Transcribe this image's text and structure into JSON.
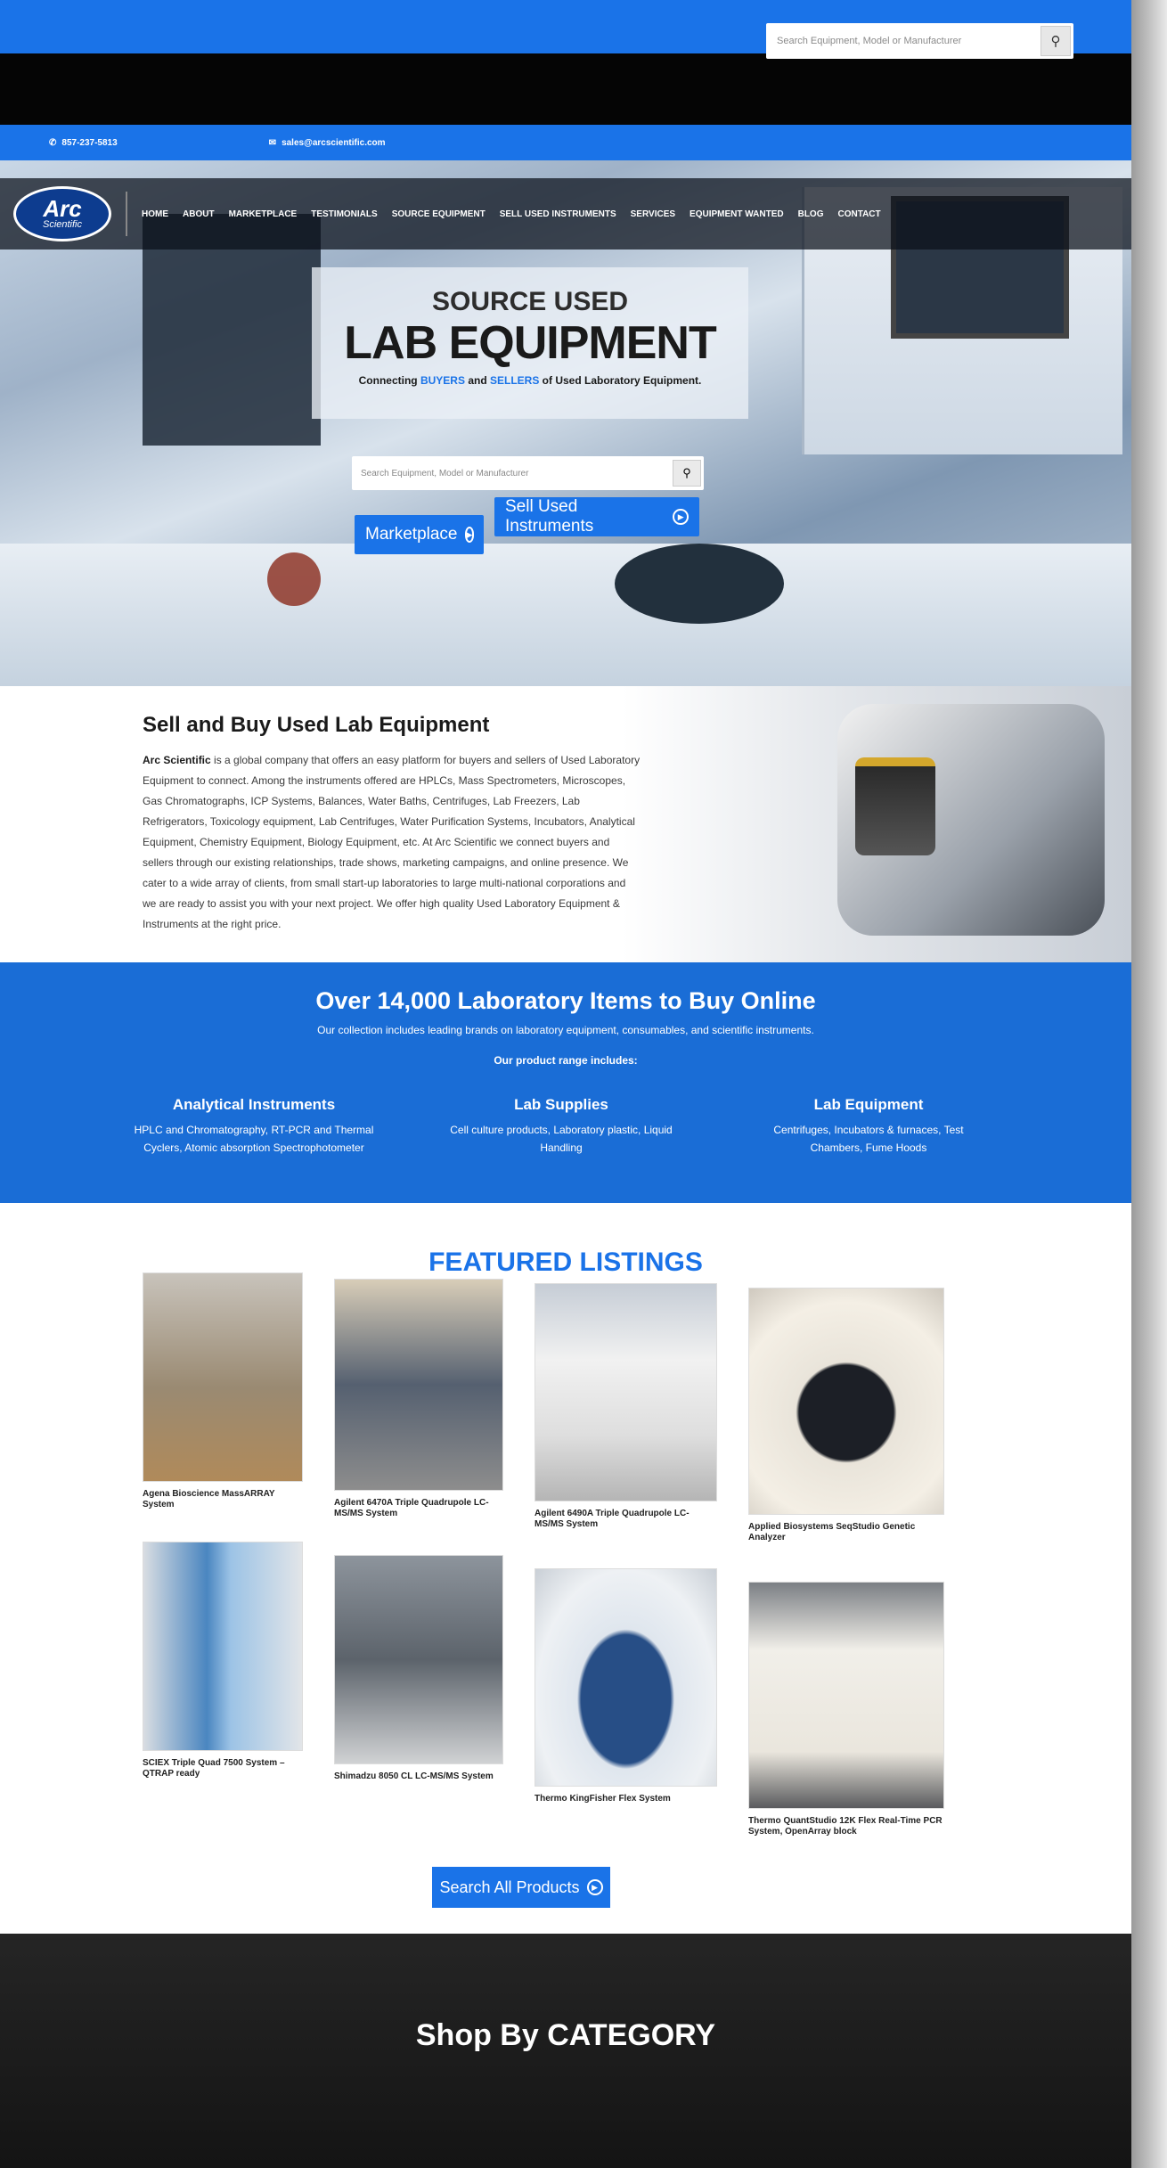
{
  "topbar": {
    "search_placeholder": "Search Equipment, Model or Manufacturer",
    "phone": "857-237-5813",
    "email": "sales@arcscientific.com"
  },
  "logo": {
    "line1": "Arc",
    "line2": "Scientific"
  },
  "nav": {
    "items": [
      "HOME",
      "ABOUT",
      "MARKETPLACE",
      "TESTIMONIALS",
      "SOURCE EQUIPMENT",
      "SELL USED INSTRUMENTS",
      "SERVICES",
      "EQUIPMENT WANTED",
      "BLOG",
      "CONTACT"
    ]
  },
  "hero": {
    "line1": "SOURCE USED",
    "line2": "LAB EQUIPMENT",
    "sub_pre": "Connecting ",
    "sub_buyers": "BUYERS",
    "sub_mid": " and ",
    "sub_sellers": "SELLERS",
    "sub_post": " of Used Laboratory Equipment.",
    "search_placeholder": "Search Equipment, Model or Manufacturer",
    "btn_marketplace": "Marketplace",
    "btn_sell": "Sell Used Instruments"
  },
  "about": {
    "title": "Sell and Buy Used Lab Equipment",
    "company": "Arc Scientific",
    "body": " is a global company that offers an easy platform for buyers and sellers of Used Laboratory Equipment to connect. Among the instruments offered are HPLCs, Mass Spectrometers, Microscopes, Gas Chromatographs, ICP Systems, Balances, Water Baths, Centrifuges, Lab Freezers, Lab Refrigerators, Toxicology equipment, Lab Centrifuges, Water Purification Systems, Incubators, Analytical Equipment, Chemistry Equipment, Biology Equipment, etc. At Arc Scientific we connect buyers and sellers through our existing relationships, trade shows, marketing campaigns, and online presence. We cater to a wide array of clients, from small start-up laboratories to large multi-national corporations and we are ready to assist you with your next project. We offer high quality Used Laboratory Equipment & Instruments at the right price."
  },
  "range": {
    "title": "Over 14,000 Laboratory Items to Buy Online",
    "subtitle": "Our collection includes leading brands on laboratory equipment, consumables, and scientific instruments.",
    "lead": "Our product range includes:",
    "columns": [
      {
        "title": "Analytical Instruments",
        "desc": "HPLC and Chromatography, RT-PCR and Thermal Cyclers, Atomic absorption Spectrophotometer"
      },
      {
        "title": "Lab Supplies",
        "desc": "Cell culture products, Laboratory plastic, Liquid Handling"
      },
      {
        "title": "Lab Equipment",
        "desc": "Centrifuges, Incubators & furnaces, Test Chambers, Fume Hoods"
      }
    ]
  },
  "featured": {
    "title": "FEATURED LISTINGS",
    "listings": [
      "Agena Bioscience MassARRAY System",
      "Agilent 6470A Triple Quadrupole LC-MS/MS System",
      "Agilent 6490A Triple Quadrupole LC-MS/MS System",
      "Applied Biosystems SeqStudio Genetic Analyzer",
      "SCIEX Triple Quad 7500 System – QTRAP ready",
      "Shimadzu 8050 CL LC-MS/MS System",
      "Thermo KingFisher Flex System",
      "Thermo QuantStudio 12K Flex Real-Time PCR System, OpenArray block"
    ],
    "search_all": "Search All Products"
  },
  "category": {
    "title": "Shop By CATEGORY"
  },
  "colors": {
    "accent": "#1a73e8",
    "range_bg": "#1a6dd6",
    "dark": "#050505"
  }
}
